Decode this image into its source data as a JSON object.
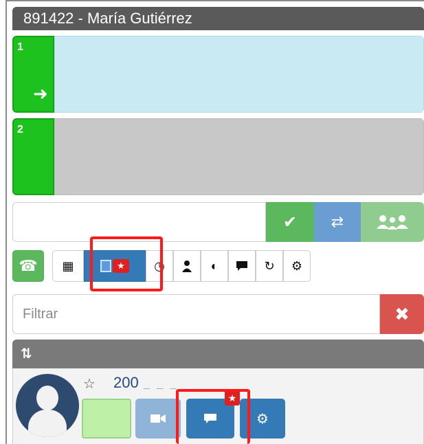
{
  "header": {
    "title": "891422 - María Gutiérrez"
  },
  "lines": [
    {
      "number": "1",
      "arrow_icon": "arrow-right-icon",
      "state": "active"
    },
    {
      "number": "2",
      "state": "idle"
    }
  ],
  "dialer": {
    "value": "",
    "placeholder": "",
    "buttons": {
      "ok": "✔",
      "transfer": "⇄",
      "conference": "conference-icon"
    }
  },
  "toolbar": {
    "phone": "☎",
    "keypad": "▦",
    "contacts_star": "★",
    "history": "◷",
    "user": "person-icon",
    "globe": "◐",
    "chat": "chat-icon",
    "refresh": "↻",
    "settings": "⚙"
  },
  "filter": {
    "placeholder": "Filtrar",
    "clear": "✖"
  },
  "contacts": {
    "sort_icon": "⇅",
    "items": [
      {
        "favorite": "☆",
        "extension": "200",
        "extension_tail": "_ _ _",
        "chat_badge": "★",
        "gear": "⚙"
      }
    ]
  },
  "colors": {
    "line_active": "#1ec21e",
    "toolbar_active": "#337ab7",
    "highlight": "#ff1a1a",
    "clear_button": "#d9534f"
  }
}
